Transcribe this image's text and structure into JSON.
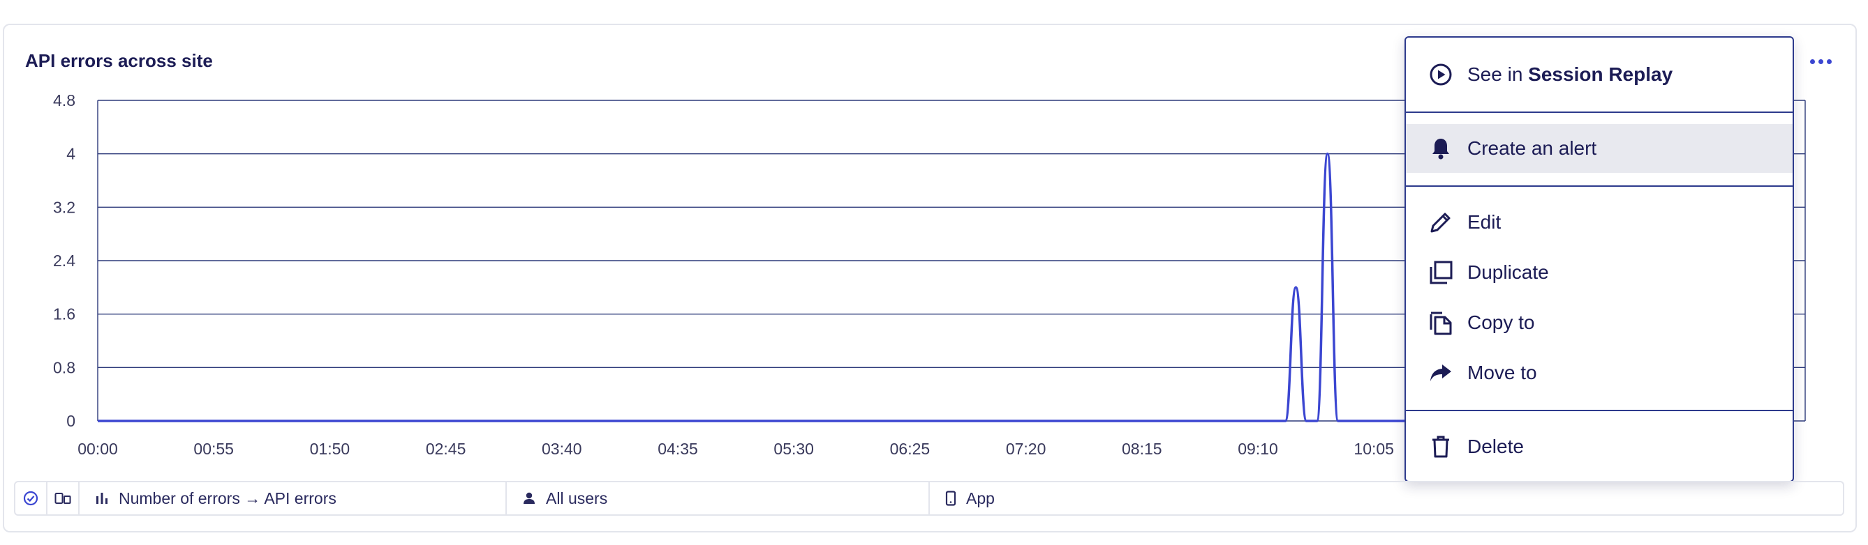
{
  "card": {
    "title": "API errors across site"
  },
  "chart_data": {
    "type": "line",
    "title": "API errors across site",
    "xlabel": "",
    "ylabel": "",
    "ylim": [
      0,
      4.8
    ],
    "y_ticks": [
      "0",
      "0.8",
      "1.6",
      "2.4",
      "3.2",
      "4",
      "4.8"
    ],
    "x_ticks": [
      "00:00",
      "00:55",
      "01:50",
      "02:45",
      "03:40",
      "04:35",
      "05:30",
      "06:25",
      "07:20",
      "08:15",
      "09:10",
      "10:05"
    ],
    "grid": true,
    "series": [
      {
        "color": "#3b46d1",
        "points": [
          {
            "t": "00:00",
            "y": 0
          },
          {
            "t": "09:23",
            "y": 0
          },
          {
            "t": "09:28",
            "y": 2
          },
          {
            "t": "09:33",
            "y": 0
          },
          {
            "t": "09:38",
            "y": 0
          },
          {
            "t": "09:43",
            "y": 4
          },
          {
            "t": "09:48",
            "y": 0
          },
          {
            "t": "11:59",
            "y": 0
          }
        ]
      }
    ]
  },
  "menu": {
    "items": [
      {
        "prefix": "See in ",
        "strong": "Session Replay",
        "icon": "play-circle-icon"
      },
      {
        "label": "Create an alert",
        "icon": "bell-icon"
      },
      {
        "label": "Edit",
        "icon": "pencil-icon"
      },
      {
        "label": "Duplicate",
        "icon": "duplicate-icon"
      },
      {
        "label": "Copy to",
        "icon": "copy-to-icon"
      },
      {
        "label": "Move to",
        "icon": "share-arrow-icon"
      },
      {
        "label": "Delete",
        "icon": "trash-icon"
      }
    ]
  },
  "filters": {
    "metric": "Number of errors → API errors",
    "users": "All users",
    "platform": "App"
  },
  "colors": {
    "accent": "#3b46d1",
    "text": "#1c1c55",
    "grid": "#2d3a7a",
    "menu_highlight": "#e8e9ef"
  }
}
